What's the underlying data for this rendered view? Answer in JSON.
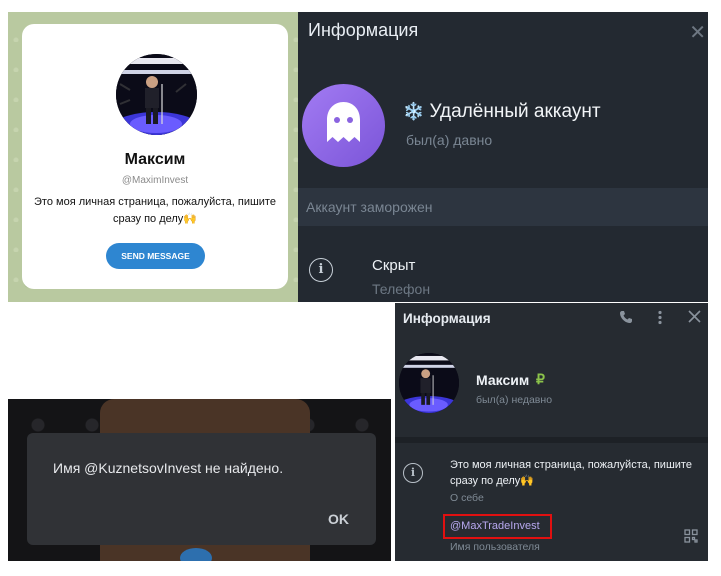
{
  "panel_web_profile": {
    "name": "Максим",
    "username": "@MaximInvest",
    "bio": "Это моя личная страница, пожалуйста, пишите сразу по делу🙌",
    "send_button": "SEND MESSAGE"
  },
  "panel_deleted_info": {
    "title": "Информация",
    "close": "✕",
    "account_emoji": "❄️",
    "account_name": "Удалённый аккаунт",
    "last_seen": "был(а) давно",
    "frozen_text": "Аккаунт заморожен",
    "phone_value": "Скрыт",
    "phone_label": "Телефон"
  },
  "panel_error_dialog": {
    "message": "Имя @KuznetsovInvest не найдено.",
    "ok_button": "OK"
  },
  "panel_profile_info": {
    "title": "Информация",
    "name": "Максим",
    "name_badge": "₽",
    "last_seen": "был(а) недавно",
    "bio": "Это моя личная страница, пожалуйста, пишите сразу по делу🙌",
    "bio_label": "О себе",
    "username": "@MaxTradeInvest",
    "username_label": "Имя пользователя",
    "highlight_color": "#e01010"
  }
}
